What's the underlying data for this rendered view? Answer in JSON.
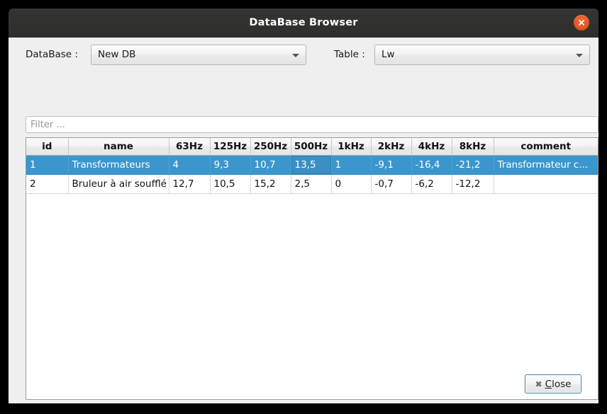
{
  "window": {
    "title": "DataBase Browser",
    "close_icon": "window-close-icon",
    "accent": "#e2531f",
    "selection_color": "#3a96cd"
  },
  "controls": {
    "database_label": "DataBase :",
    "database_value": "New DB",
    "table_label": "Table :",
    "table_value": "Lw",
    "dropdown_icon": "chevron-down-icon"
  },
  "filter": {
    "value": "",
    "placeholder": "Filter ..."
  },
  "table": {
    "columns": [
      "id",
      "name",
      "63Hz",
      "125Hz",
      "250Hz",
      "500Hz",
      "1kHz",
      "2kHz",
      "4kHz",
      "8kHz",
      "comment"
    ],
    "rows": [
      {
        "selected": true,
        "cells": [
          "1",
          "Transformateurs",
          "4",
          "9,3",
          "10,7",
          "13,5",
          "1",
          "-9,1",
          "-16,4",
          "-21,2",
          "Transformateur c..."
        ]
      },
      {
        "selected": false,
        "cells": [
          "2",
          "Bruleur à air soufflé",
          "12,7",
          "10,5",
          "15,2",
          "2,5",
          "0",
          "-0,7",
          "-6,2",
          "-12,2",
          ""
        ]
      }
    ]
  },
  "footer": {
    "close_icon": "x-mark-icon",
    "close_label_mnemonic": "C",
    "close_label_rest": "lose"
  }
}
